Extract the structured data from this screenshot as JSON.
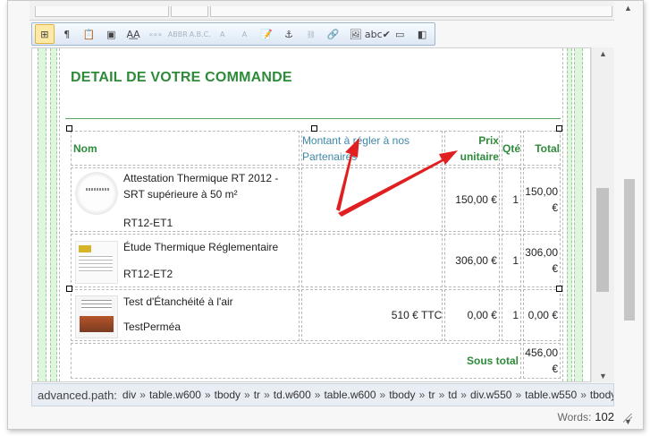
{
  "toolbar": {
    "buttons": [
      {
        "name": "show-blocks-button",
        "glyph": "⊞",
        "active": true
      },
      {
        "name": "show-paragraph-marks-button",
        "glyph": "¶"
      },
      {
        "name": "paste-as-text-button",
        "glyph": "📋"
      },
      {
        "name": "insert-field-button",
        "glyph": "▣"
      },
      {
        "name": "font-style-button",
        "glyph": "A͟A"
      },
      {
        "name": "quote-button",
        "glyph": "««»",
        "dim": true
      },
      {
        "name": "abbr-button",
        "glyph": "ABBR",
        "dim": true
      },
      {
        "name": "acronym-button",
        "glyph": "A.B.C.",
        "dim": true
      },
      {
        "name": "strikethrough-a-button",
        "glyph": "A",
        "dim": true
      },
      {
        "name": "underline-a-button",
        "glyph": "A",
        "dim": true
      },
      {
        "name": "insert-template-button",
        "glyph": "📝"
      },
      {
        "name": "insert-anchor-button",
        "glyph": "⚓"
      },
      {
        "name": "unlink-button",
        "glyph": "⛓",
        "dim": true
      },
      {
        "name": "link-button",
        "glyph": "🔗"
      },
      {
        "name": "insert-image-button",
        "glyph": "🖼"
      },
      {
        "name": "spellcheck-button",
        "glyph": "abc✔"
      },
      {
        "name": "horizontal-layout-button",
        "glyph": "▭"
      },
      {
        "name": "split-layout-button",
        "glyph": "◧"
      }
    ]
  },
  "document": {
    "heading": "DETAIL DE VOTRE COMMANDE",
    "columns": {
      "nom": "Nom",
      "montant": "Montant à régler à nos Partenaires",
      "prix": "Prix unitaire",
      "qte": "Qté",
      "total": "Total"
    },
    "rows": [
      {
        "title": "Attestation Thermique RT 2012 - SRT supérieure à 50 m²",
        "ref": "RT12-ET1",
        "montant": "",
        "prix": "150,00 €",
        "qte": "1",
        "total": "150,00 €"
      },
      {
        "title": "Étude Thermique Réglementaire",
        "ref": "RT12-ET2",
        "montant": "",
        "prix": "306,00 €",
        "qte": "1",
        "total": "306,00 €"
      },
      {
        "title": "Test d'Étanchéité à l'air",
        "ref": "TestPerméa",
        "montant": "510 € TTC",
        "prix": "0,00 €",
        "qte": "1",
        "total": "0,00 €"
      }
    ],
    "subtotal_label": "Sous total",
    "subtotal_value": "456,00 €"
  },
  "path_bar": {
    "label": "advanced.path:",
    "segments": [
      "div",
      "table.w600",
      "tbody",
      "tr",
      "td.w600",
      "table.w600",
      "tbody",
      "tr",
      "td",
      "div.w550",
      "table.w550",
      "tbody"
    ]
  },
  "status": {
    "words_label": "Words:",
    "words_count": "102"
  },
  "colors": {
    "heading_green": "#2e8b3a",
    "montant_blue": "#3d88a6",
    "arrow_red": "#e02020"
  }
}
